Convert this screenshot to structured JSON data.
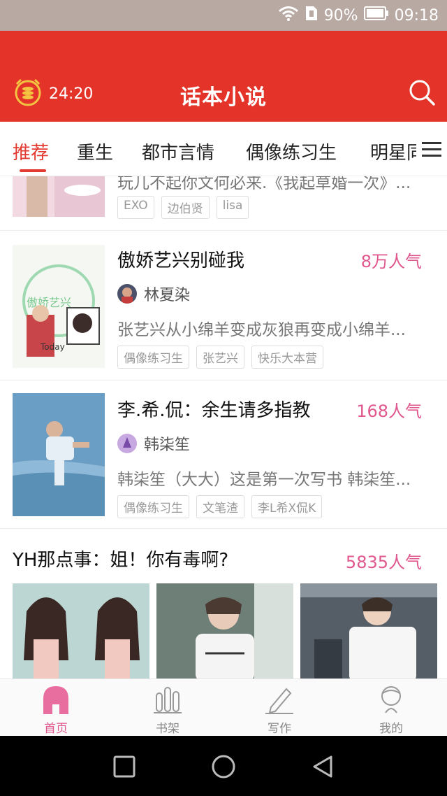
{
  "status_bar": {
    "battery": "90%",
    "time": "09:18",
    "icons": [
      "wifi-icon",
      "sim-icon",
      "battery-icon"
    ]
  },
  "header": {
    "timer": "24:20",
    "title": "话本小说",
    "timer_icon": "alarm-coin-icon",
    "search_icon": "search-icon"
  },
  "tabs": [
    {
      "label": "推荐",
      "active": true
    },
    {
      "label": "重生",
      "active": false
    },
    {
      "label": "都市言情",
      "active": false
    },
    {
      "label": "偶像练习生",
      "active": false
    },
    {
      "label": "明星同",
      "active": false
    }
  ],
  "books": [
    {
      "title": "",
      "popularity": "",
      "author": "",
      "desc": "玩儿不起你文何必来.《我起草婚一次》...",
      "tags": [
        "EXO",
        "边伯贤",
        "lisa"
      ]
    },
    {
      "title": "傲娇艺兴别碰我",
      "popularity": "8万人气",
      "author": "林夏染",
      "desc": "张艺兴从小绵羊变成灰狼再变成小绵羊...",
      "tags": [
        "偶像练习生",
        "张艺兴",
        "快乐大本营"
      ]
    },
    {
      "title": "李.希.侃：余生请多指教",
      "popularity": "168人气",
      "author": "韩柒笙",
      "desc": "韩柒笙（大大）这是第一次写书 韩柒笙...",
      "tags": [
        "偶像练习生",
        "文笔渣",
        "李L希X侃K"
      ]
    }
  ],
  "feature": {
    "title": "YH那点事：姐！你有毒啊?",
    "popularity": "5835人气"
  },
  "bottom_nav": [
    {
      "label": "首页",
      "icon": "home-icon",
      "active": true
    },
    {
      "label": "书架",
      "icon": "bookshelf-icon",
      "active": false
    },
    {
      "label": "写作",
      "icon": "pen-icon",
      "active": false
    },
    {
      "label": "我的",
      "icon": "profile-icon",
      "active": false
    }
  ],
  "colors": {
    "header_red": "#e43328",
    "accent_pink": "#e0578e",
    "tab_active": "#e23a30"
  }
}
